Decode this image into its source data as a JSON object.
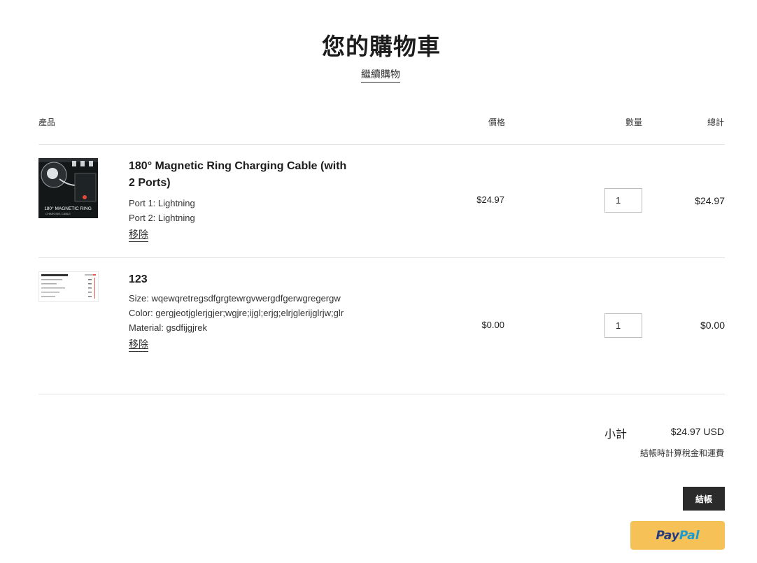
{
  "page": {
    "title": "您的購物車",
    "continue_shopping": "繼續購物"
  },
  "table": {
    "headers": {
      "product": "產品",
      "price": "價格",
      "quantity": "數量",
      "total": "總計"
    }
  },
  "items": [
    {
      "name": "180° Magnetic Ring Charging Cable (with 2 Ports)",
      "options": [
        "Port 1: Lightning",
        "Port 2: Lightning"
      ],
      "remove_label": "移除",
      "price": "$24.97",
      "quantity": "1",
      "line_total": "$24.97",
      "thumb_text": "180° MAGNETIC RING",
      "thumb_subtext": "CHARGING CABLE"
    },
    {
      "name": "123",
      "options": [
        "Size: wqewqretregsdfgrgtewrgvwergdfgerwgregergw",
        "Color: gergjeotjglerjgjer;wgjre;ijgl;erjg;elrjglerijglrjw;glr",
        "Material: gsdfijgjrek"
      ],
      "remove_label": "移除",
      "price": "$0.00",
      "quantity": "1",
      "line_total": "$0.00"
    }
  ],
  "summary": {
    "subtotal_label": "小計",
    "subtotal_value": "$24.97 USD",
    "tax_note": "結帳時計算稅金和運費",
    "checkout_label": "結帳",
    "paypal_label_dark": "Pay",
    "paypal_label_light": "Pal"
  },
  "colors": {
    "checkout_bg": "#2b2b2b",
    "paypal_bg": "#f6c157"
  }
}
